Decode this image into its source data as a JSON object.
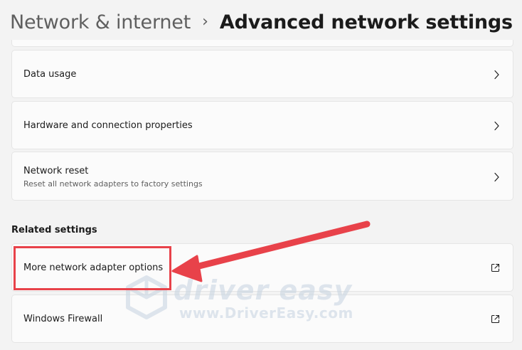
{
  "breadcrumb": {
    "parent": "Network & internet",
    "separator": "›",
    "current": "Advanced network settings"
  },
  "cards": {
    "data_usage": {
      "label": "Data usage",
      "icon": "chevron-right-icon"
    },
    "hardware": {
      "label": "Hardware and connection properties",
      "icon": "chevron-right-icon"
    },
    "network_reset": {
      "label": "Network reset",
      "description": "Reset all network adapters to factory settings",
      "icon": "chevron-right-icon"
    }
  },
  "related": {
    "title": "Related settings",
    "adapter_options": {
      "label": "More network adapter options",
      "icon": "external-link-icon"
    },
    "firewall": {
      "label": "Windows Firewall",
      "icon": "external-link-icon"
    }
  },
  "annotation": {
    "color": "#e8424a"
  },
  "watermark": {
    "brand": "driver easy",
    "url": "www.DriverEasy.com"
  }
}
